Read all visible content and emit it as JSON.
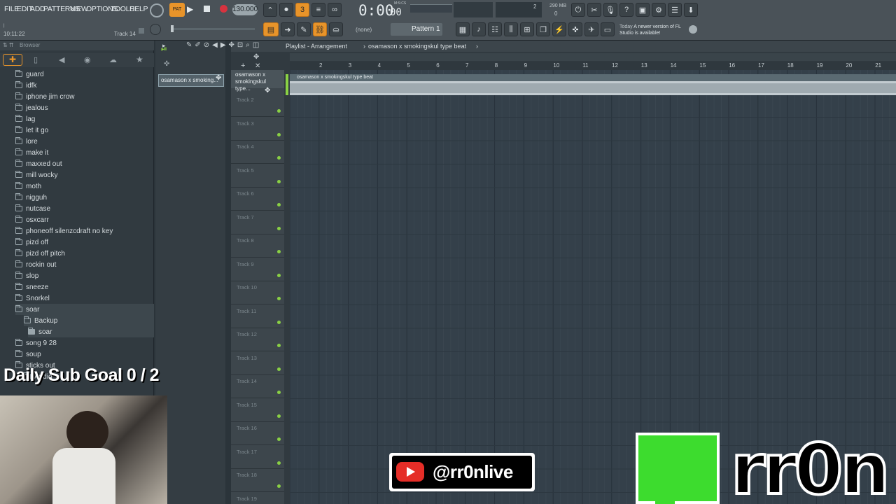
{
  "menu": {
    "items": [
      "FILE",
      "EDIT",
      "ADD",
      "PATTERNS",
      "VIEW",
      "OPTIONS",
      "TOOLS",
      "HELP"
    ]
  },
  "transport": {
    "tempo": "130.000",
    "time": "0:00",
    "time_sub": "00",
    "time_unit": "M:S:CS",
    "cpu_label": "290 MB",
    "cpu_num": "2",
    "cpu_zero": "0",
    "ptn_none": "(none)",
    "pattern": "Pattern 1",
    "hint_day": "Today",
    "hint_text": "A newer version of FL Studio is available!"
  },
  "status": {
    "clock": "10:11:22",
    "track_hint": "Track 14"
  },
  "browser": {
    "title": "Browser",
    "items": [
      "guard",
      "idfk",
      "iphone jim crow",
      "jealous",
      "lag",
      "let it go",
      "lore",
      "make it",
      "maxxed out",
      "mill wocky",
      "moth",
      "nigguh",
      "nutcase",
      "osxcarr",
      "phoneoff silenzcdraft no key",
      "pizd off",
      "pizd off pitch",
      "rockin out",
      "slop",
      "sneeze",
      "Snorkel",
      "soar",
      "Backup",
      "soar",
      "song 9 28",
      "soup",
      "sticks out",
      "Audio"
    ]
  },
  "picker": {
    "clip_name": "osamason x smoking..."
  },
  "playlist": {
    "breadcrumb": "Playlist - Arrangement",
    "project": "osamason x smokingskul type beat",
    "track1_name": "osamason x smokingskul type...",
    "clip_label": "osamason x smokingskul type beat",
    "ruler": [
      "2",
      "3",
      "4",
      "5",
      "6",
      "7",
      "8",
      "9",
      "10",
      "11",
      "12",
      "13",
      "14",
      "15",
      "16",
      "17",
      "18",
      "19",
      "20",
      "21"
    ],
    "tracks": [
      "Track 2",
      "Track 3",
      "Track 4",
      "Track 5",
      "Track 6",
      "Track 7",
      "Track 8",
      "Track 9",
      "Track 10",
      "Track 11",
      "Track 12",
      "Track 13",
      "Track 14",
      "Track 15",
      "Track 16",
      "Track 17",
      "Track 18",
      "Track 19"
    ]
  },
  "overlay": {
    "sub_goal": "Daily Sub Goal  0 / 2",
    "handle": "@rr0nlive",
    "logo_text": "rr0n"
  },
  "colors": {
    "accent": "#e8942a",
    "green": "#8ad144",
    "logo_green": "#3ddc2e"
  }
}
